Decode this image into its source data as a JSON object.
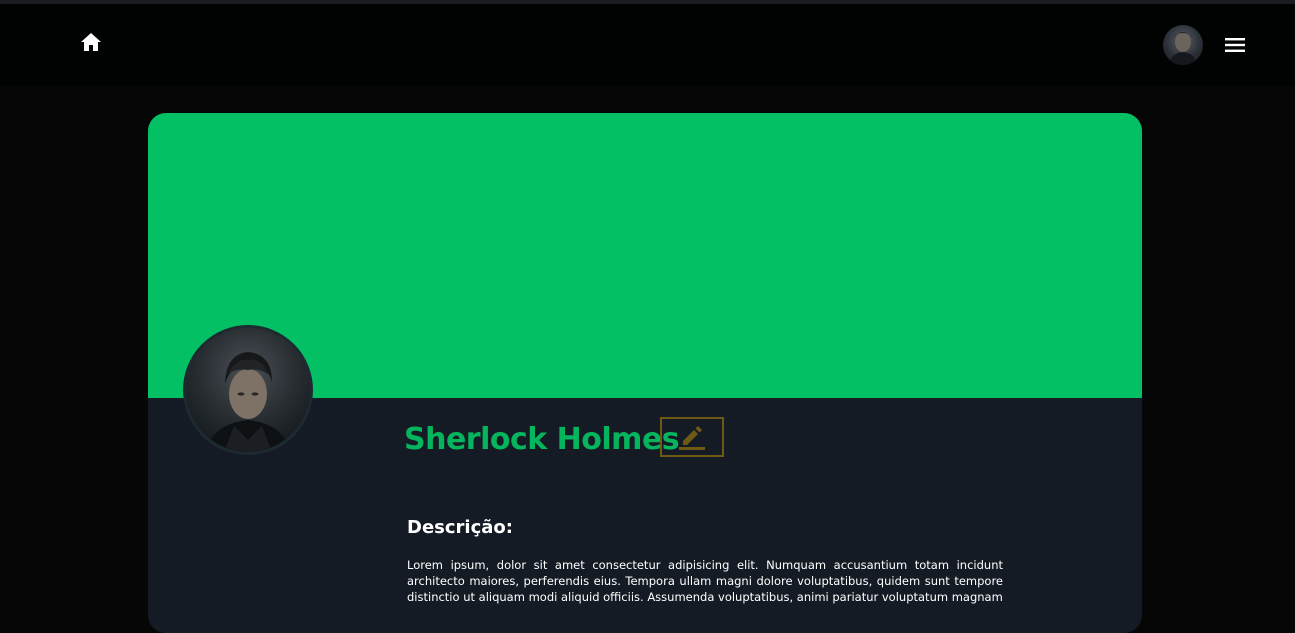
{
  "navbar": {
    "home_icon": "home-icon",
    "menu_icon": "hamburger-menu-icon"
  },
  "profile": {
    "name": "Sherlock Holmes",
    "edit_icon": "pencil-icon",
    "banner_color": "#03c064",
    "name_color": "#05b55e"
  },
  "description": {
    "heading": "Descrição:",
    "text": "Lorem ipsum, dolor sit amet consectetur adipisicing elit. Numquam accusantium totam incidunt architecto maiores, perferendis eius. Tempora ullam magni dolore voluptatibus, quidem sunt tempore distinctio ut aliquam modi aliquid officiis. Assumenda voluptatibus, animi pariatur voluptatum magnam"
  }
}
